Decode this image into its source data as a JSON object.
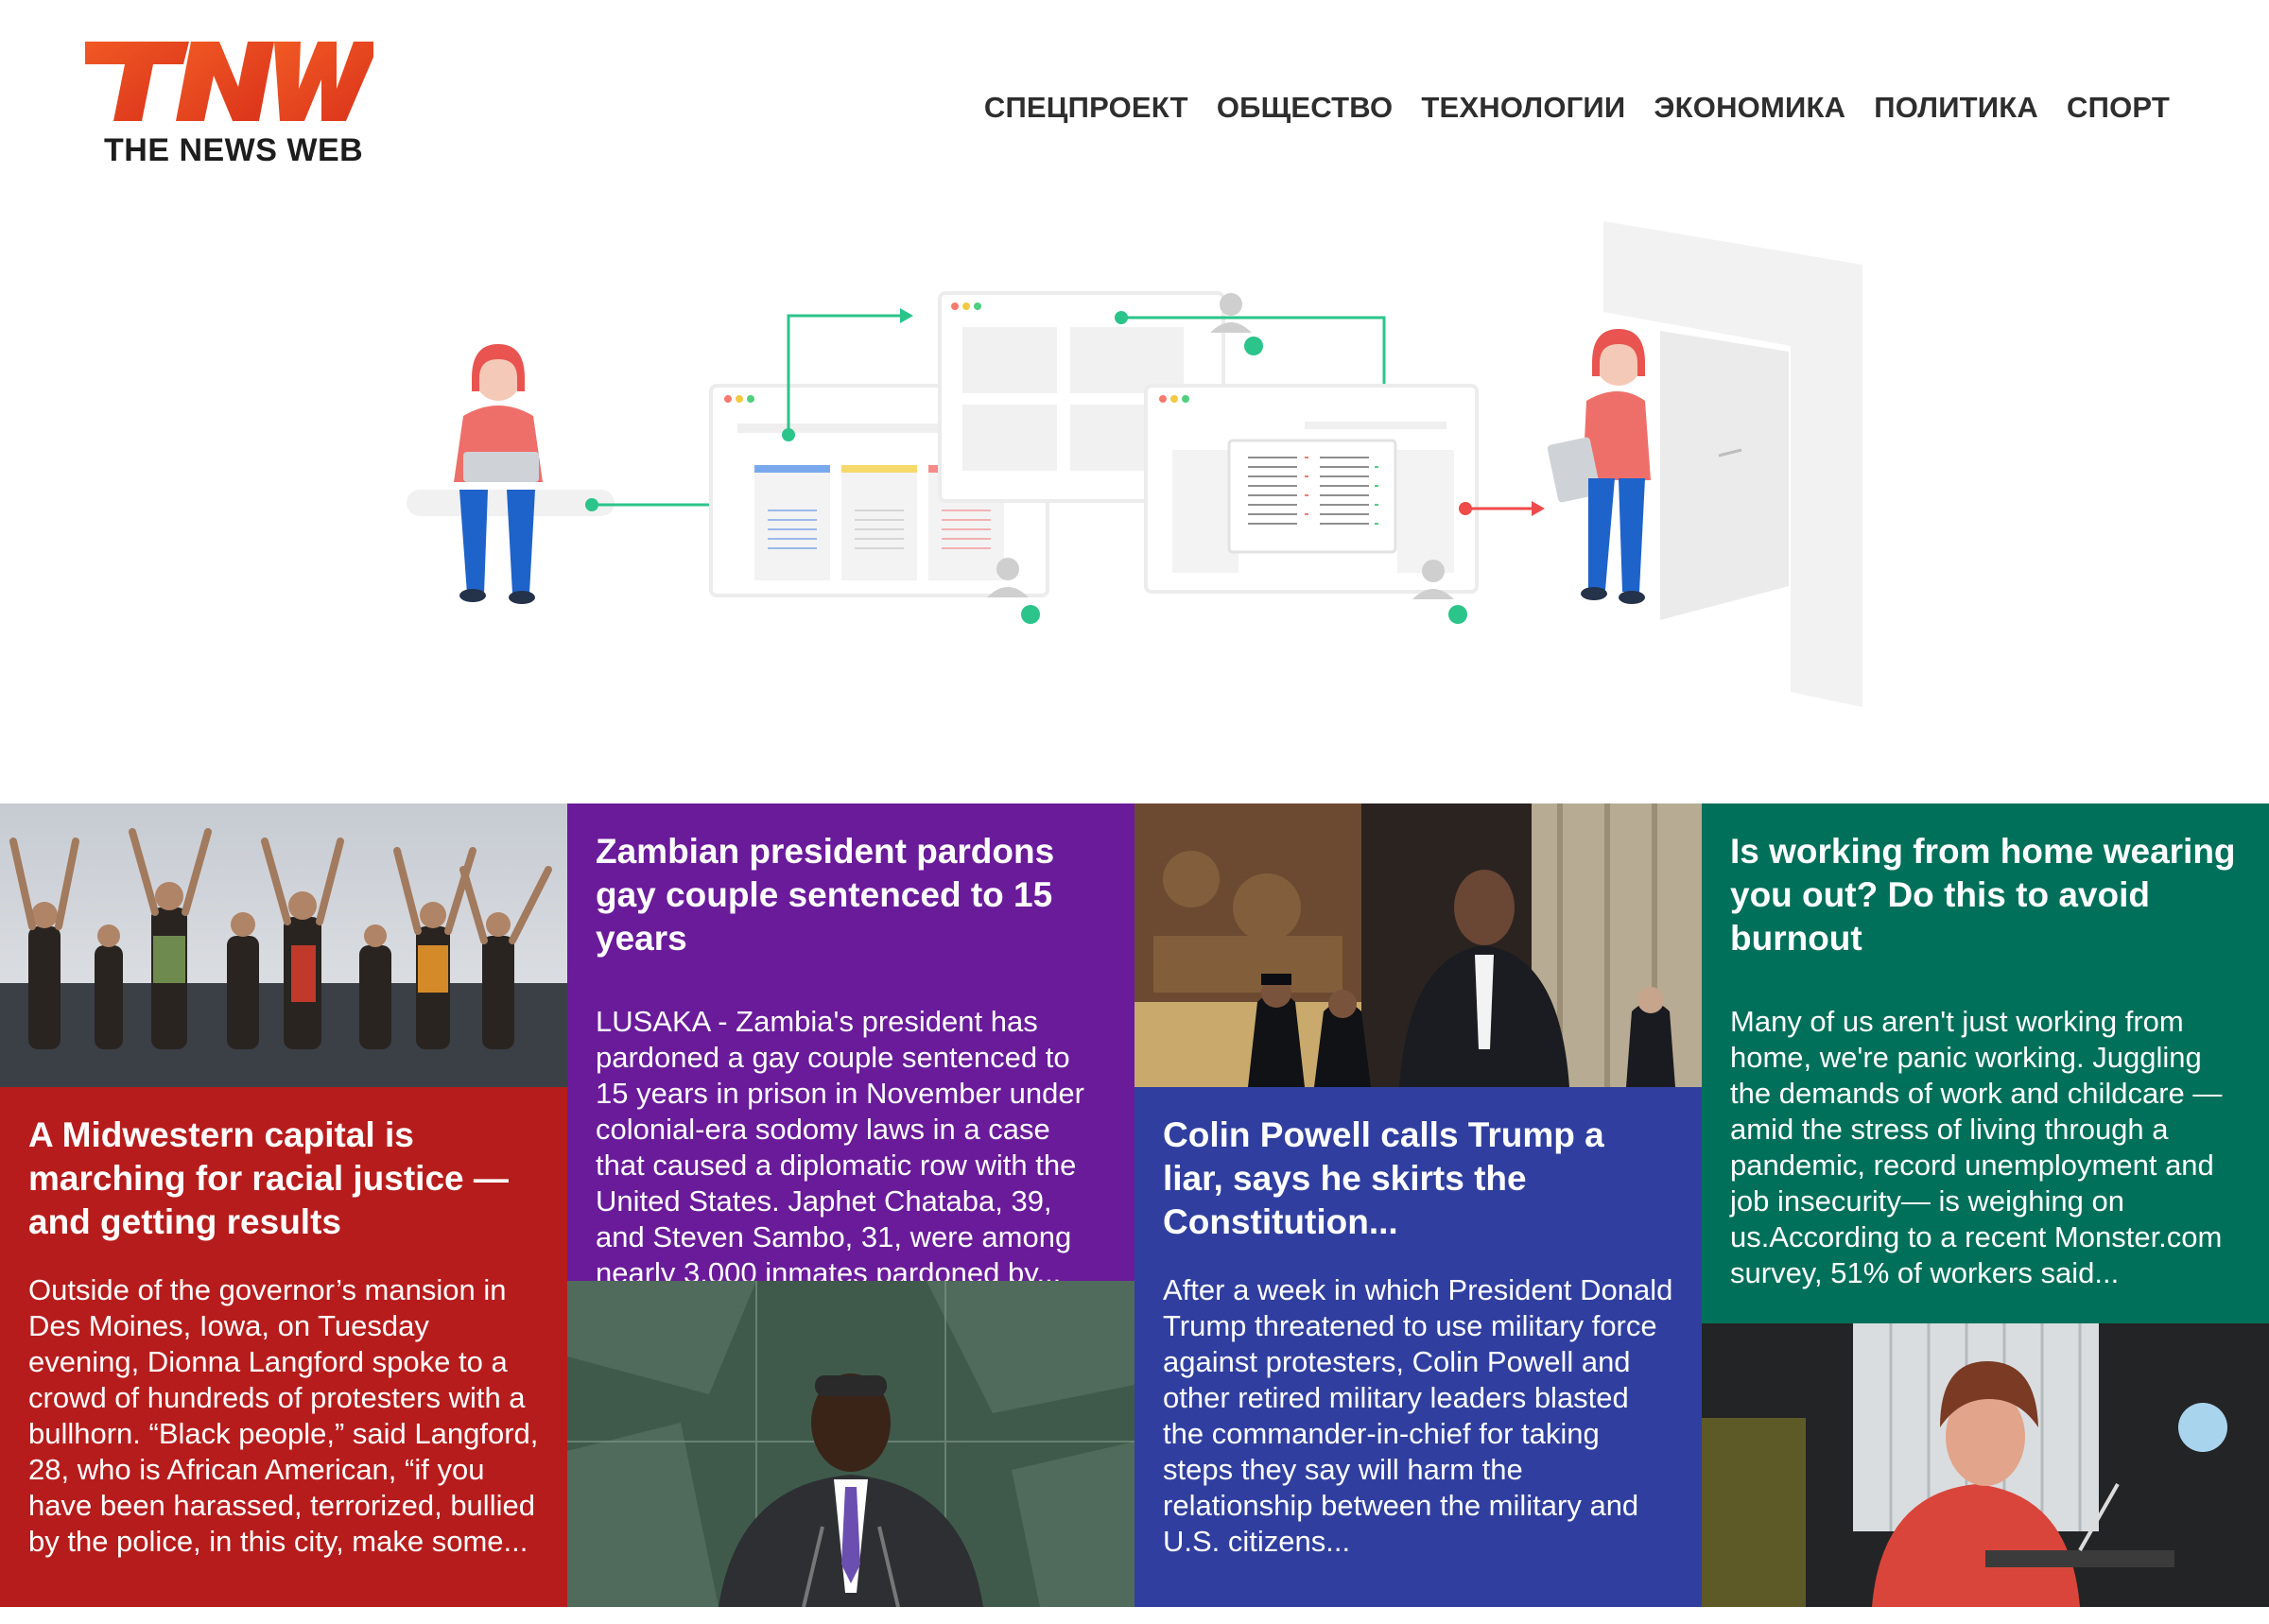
{
  "brand": {
    "logo_letters": "TNW",
    "logo_tagline": "THE NEWS WEB",
    "accent_color": "#e8401c"
  },
  "nav": {
    "items": [
      {
        "label": "СПЕЦПРОЕКТ"
      },
      {
        "label": "ОБЩЕСТВО"
      },
      {
        "label": "ТЕХНОЛОГИИ"
      },
      {
        "label": "ЭКОНОМИКА"
      },
      {
        "label": "ПОЛИТИКА"
      },
      {
        "label": "СПОРТ"
      }
    ]
  },
  "articles": [
    {
      "headline": "A Midwestern capital is marching for racial justice — and getting results",
      "excerpt": "Outside of the governor’s mansion in Des Moines, Iowa, on Tuesday evening, Dionna Langford spoke to a crowd of hundreds of protesters with a bullhorn. “Black people,” said Langford, 28, who is African American, “if you have been harassed, terrorized, bullied by the police, in this city, make some...",
      "color": "#b71c1c",
      "image": "protest-photo"
    },
    {
      "headline": "Zambian president pardons gay couple sentenced to 15 years",
      "excerpt": "LUSAKA - Zambia's president has pardoned a gay couple sentenced to 15 years in prison in November under colonial-era sodomy laws in a case that caused a diplomatic row with the United States. Japhet Chataba, 39, and Steven Sambo, 31, were among nearly 3,000 inmates pardoned by...",
      "color": "#6a1b9a",
      "image": "president-speech-photo"
    },
    {
      "headline": "Colin Powell calls Trump a liar, says he skirts the Constitution...",
      "excerpt": "After a week in which President Donald Trump threatened to use military force against protesters, Colin Powell and other retired military leaders blasted the commander-in-chief for taking steps they say will harm the relationship between the military and U.S. citizens...",
      "color": "#303f9f",
      "image": "capitol-photo"
    },
    {
      "headline": "Is working from home wearing you out? Do this to avoid burnout",
      "excerpt": "Many of us aren't just working from home, we're panic working. Juggling the demands of work and childcare — amid the stress of living through a pandemic, record unemployment and job insecurity— is weighing on us.According to a recent Monster.com survey, 51% of workers said...",
      "color": "#00705a",
      "image": "woman-at-laptop-photo"
    }
  ]
}
